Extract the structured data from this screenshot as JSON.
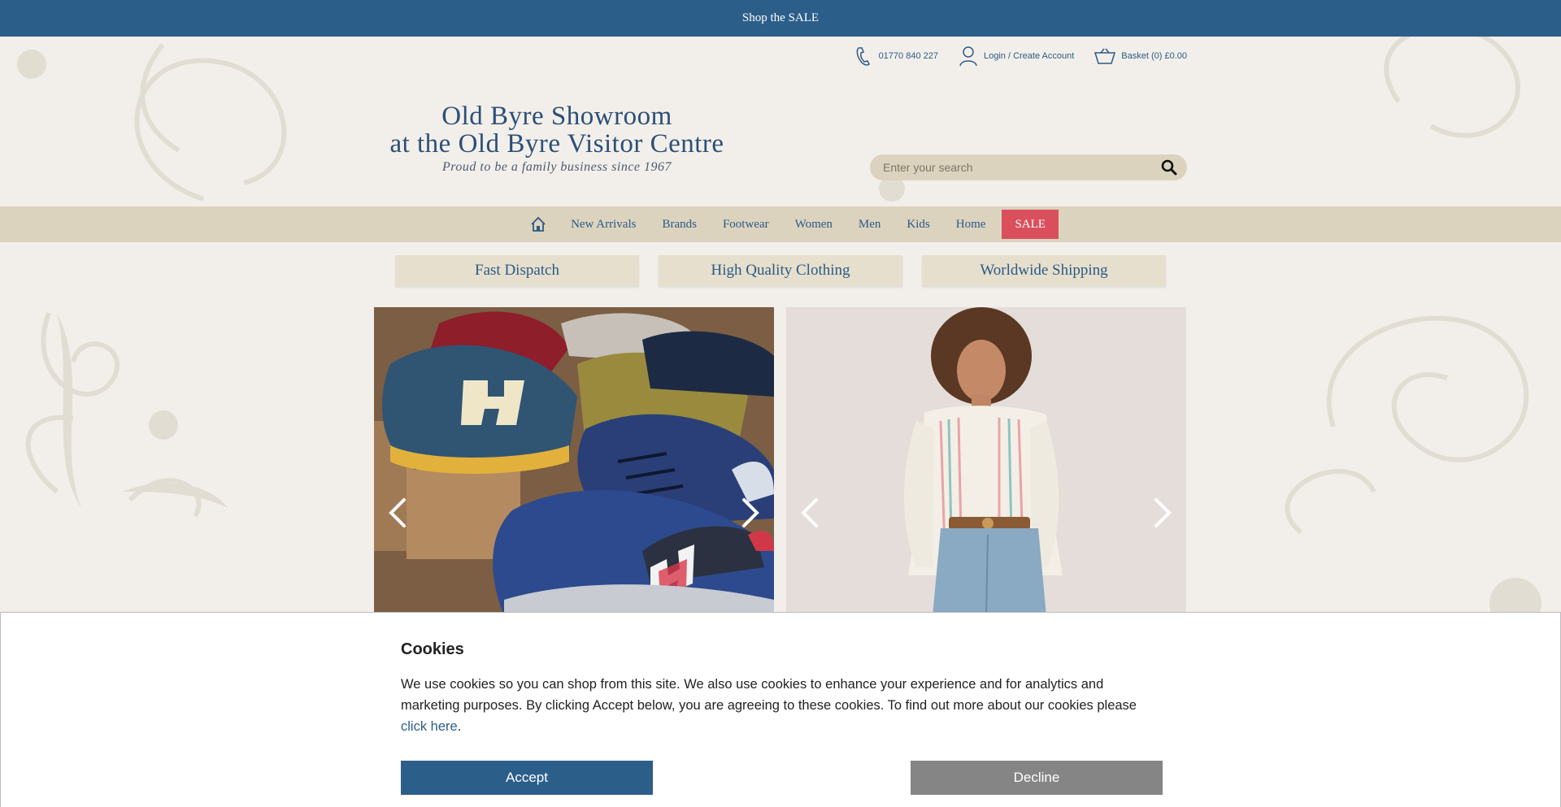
{
  "announcement": {
    "text": "Shop the SALE"
  },
  "utility": {
    "phone": "01770 840 227",
    "login": "Login / Create Account",
    "basket": "Basket (0) £0.00"
  },
  "logo": {
    "line1": "Old Byre Showroom",
    "line2": "at the Old Byre Visitor Centre",
    "tagline": "Proud to be a family business since 1967"
  },
  "search": {
    "placeholder": "Enter your search"
  },
  "nav": {
    "items": [
      "New Arrivals",
      "Brands",
      "Footwear",
      "Women",
      "Men",
      "Kids",
      "Home"
    ],
    "sale": "SALE"
  },
  "features": [
    "Fast Dispatch",
    "High Quality Clothing",
    "Worldwide Shipping"
  ],
  "cookie": {
    "title": "Cookies",
    "body": "We use cookies so you can shop from this site. We also use cookies to enhance your experience and for analytics and marketing purposes. By clicking Accept below, you are agreeing to these cookies. To find out more about our cookies please ",
    "link": "click here",
    "period": ".",
    "accept": "Accept",
    "decline": "Decline"
  },
  "colors": {
    "brand_blue": "#2c5e8a",
    "nav_beige": "#dcd3bf",
    "sale_red": "#d9505c",
    "decline_grey": "#858585"
  }
}
